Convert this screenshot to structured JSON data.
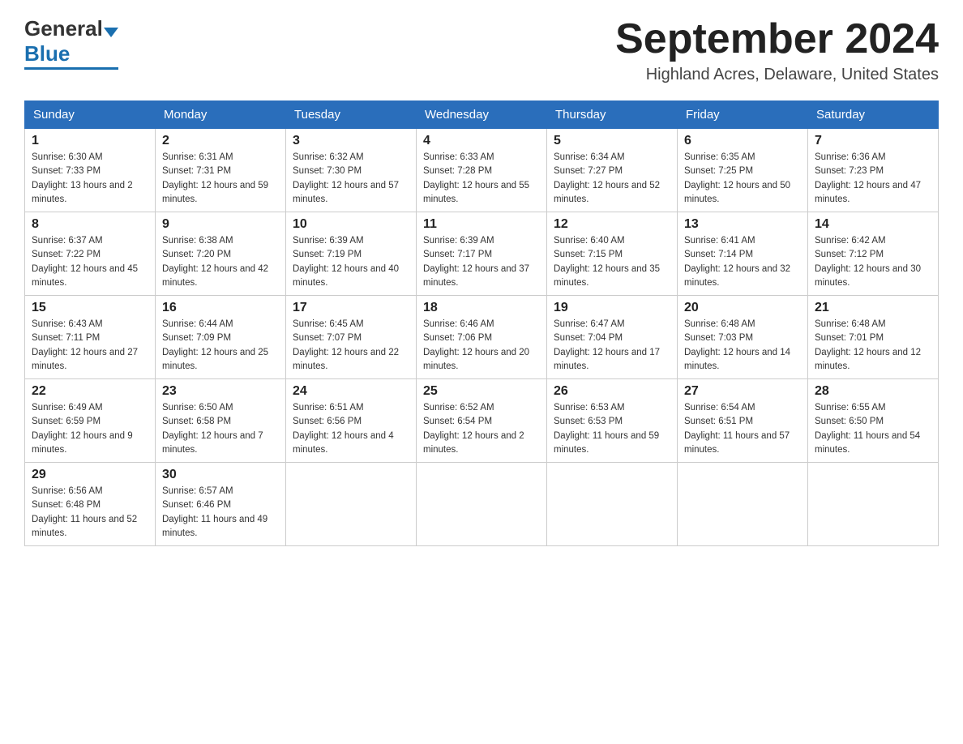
{
  "header": {
    "logo_text_general": "General",
    "logo_text_blue": "Blue",
    "month_title": "September 2024",
    "location": "Highland Acres, Delaware, United States"
  },
  "calendar": {
    "days_of_week": [
      "Sunday",
      "Monday",
      "Tuesday",
      "Wednesday",
      "Thursday",
      "Friday",
      "Saturday"
    ],
    "weeks": [
      [
        {
          "day": "1",
          "sunrise": "Sunrise: 6:30 AM",
          "sunset": "Sunset: 7:33 PM",
          "daylight": "Daylight: 13 hours and 2 minutes."
        },
        {
          "day": "2",
          "sunrise": "Sunrise: 6:31 AM",
          "sunset": "Sunset: 7:31 PM",
          "daylight": "Daylight: 12 hours and 59 minutes."
        },
        {
          "day": "3",
          "sunrise": "Sunrise: 6:32 AM",
          "sunset": "Sunset: 7:30 PM",
          "daylight": "Daylight: 12 hours and 57 minutes."
        },
        {
          "day": "4",
          "sunrise": "Sunrise: 6:33 AM",
          "sunset": "Sunset: 7:28 PM",
          "daylight": "Daylight: 12 hours and 55 minutes."
        },
        {
          "day": "5",
          "sunrise": "Sunrise: 6:34 AM",
          "sunset": "Sunset: 7:27 PM",
          "daylight": "Daylight: 12 hours and 52 minutes."
        },
        {
          "day": "6",
          "sunrise": "Sunrise: 6:35 AM",
          "sunset": "Sunset: 7:25 PM",
          "daylight": "Daylight: 12 hours and 50 minutes."
        },
        {
          "day": "7",
          "sunrise": "Sunrise: 6:36 AM",
          "sunset": "Sunset: 7:23 PM",
          "daylight": "Daylight: 12 hours and 47 minutes."
        }
      ],
      [
        {
          "day": "8",
          "sunrise": "Sunrise: 6:37 AM",
          "sunset": "Sunset: 7:22 PM",
          "daylight": "Daylight: 12 hours and 45 minutes."
        },
        {
          "day": "9",
          "sunrise": "Sunrise: 6:38 AM",
          "sunset": "Sunset: 7:20 PM",
          "daylight": "Daylight: 12 hours and 42 minutes."
        },
        {
          "day": "10",
          "sunrise": "Sunrise: 6:39 AM",
          "sunset": "Sunset: 7:19 PM",
          "daylight": "Daylight: 12 hours and 40 minutes."
        },
        {
          "day": "11",
          "sunrise": "Sunrise: 6:39 AM",
          "sunset": "Sunset: 7:17 PM",
          "daylight": "Daylight: 12 hours and 37 minutes."
        },
        {
          "day": "12",
          "sunrise": "Sunrise: 6:40 AM",
          "sunset": "Sunset: 7:15 PM",
          "daylight": "Daylight: 12 hours and 35 minutes."
        },
        {
          "day": "13",
          "sunrise": "Sunrise: 6:41 AM",
          "sunset": "Sunset: 7:14 PM",
          "daylight": "Daylight: 12 hours and 32 minutes."
        },
        {
          "day": "14",
          "sunrise": "Sunrise: 6:42 AM",
          "sunset": "Sunset: 7:12 PM",
          "daylight": "Daylight: 12 hours and 30 minutes."
        }
      ],
      [
        {
          "day": "15",
          "sunrise": "Sunrise: 6:43 AM",
          "sunset": "Sunset: 7:11 PM",
          "daylight": "Daylight: 12 hours and 27 minutes."
        },
        {
          "day": "16",
          "sunrise": "Sunrise: 6:44 AM",
          "sunset": "Sunset: 7:09 PM",
          "daylight": "Daylight: 12 hours and 25 minutes."
        },
        {
          "day": "17",
          "sunrise": "Sunrise: 6:45 AM",
          "sunset": "Sunset: 7:07 PM",
          "daylight": "Daylight: 12 hours and 22 minutes."
        },
        {
          "day": "18",
          "sunrise": "Sunrise: 6:46 AM",
          "sunset": "Sunset: 7:06 PM",
          "daylight": "Daylight: 12 hours and 20 minutes."
        },
        {
          "day": "19",
          "sunrise": "Sunrise: 6:47 AM",
          "sunset": "Sunset: 7:04 PM",
          "daylight": "Daylight: 12 hours and 17 minutes."
        },
        {
          "day": "20",
          "sunrise": "Sunrise: 6:48 AM",
          "sunset": "Sunset: 7:03 PM",
          "daylight": "Daylight: 12 hours and 14 minutes."
        },
        {
          "day": "21",
          "sunrise": "Sunrise: 6:48 AM",
          "sunset": "Sunset: 7:01 PM",
          "daylight": "Daylight: 12 hours and 12 minutes."
        }
      ],
      [
        {
          "day": "22",
          "sunrise": "Sunrise: 6:49 AM",
          "sunset": "Sunset: 6:59 PM",
          "daylight": "Daylight: 12 hours and 9 minutes."
        },
        {
          "day": "23",
          "sunrise": "Sunrise: 6:50 AM",
          "sunset": "Sunset: 6:58 PM",
          "daylight": "Daylight: 12 hours and 7 minutes."
        },
        {
          "day": "24",
          "sunrise": "Sunrise: 6:51 AM",
          "sunset": "Sunset: 6:56 PM",
          "daylight": "Daylight: 12 hours and 4 minutes."
        },
        {
          "day": "25",
          "sunrise": "Sunrise: 6:52 AM",
          "sunset": "Sunset: 6:54 PM",
          "daylight": "Daylight: 12 hours and 2 minutes."
        },
        {
          "day": "26",
          "sunrise": "Sunrise: 6:53 AM",
          "sunset": "Sunset: 6:53 PM",
          "daylight": "Daylight: 11 hours and 59 minutes."
        },
        {
          "day": "27",
          "sunrise": "Sunrise: 6:54 AM",
          "sunset": "Sunset: 6:51 PM",
          "daylight": "Daylight: 11 hours and 57 minutes."
        },
        {
          "day": "28",
          "sunrise": "Sunrise: 6:55 AM",
          "sunset": "Sunset: 6:50 PM",
          "daylight": "Daylight: 11 hours and 54 minutes."
        }
      ],
      [
        {
          "day": "29",
          "sunrise": "Sunrise: 6:56 AM",
          "sunset": "Sunset: 6:48 PM",
          "daylight": "Daylight: 11 hours and 52 minutes."
        },
        {
          "day": "30",
          "sunrise": "Sunrise: 6:57 AM",
          "sunset": "Sunset: 6:46 PM",
          "daylight": "Daylight: 11 hours and 49 minutes."
        },
        null,
        null,
        null,
        null,
        null
      ]
    ]
  }
}
